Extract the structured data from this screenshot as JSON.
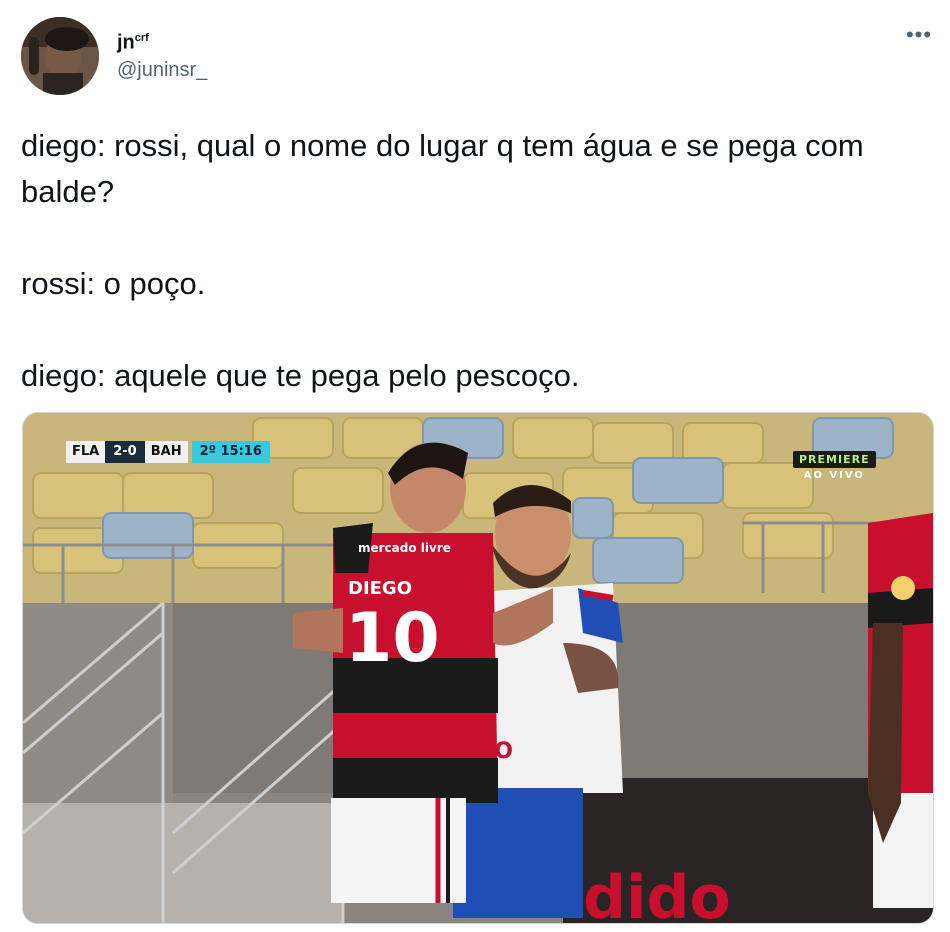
{
  "author": {
    "display_name": "jn",
    "display_name_sup": "crf",
    "handle": "@juninsr_",
    "avatar_icon": "avatar-photo"
  },
  "more_label": "•••",
  "tweet": {
    "lines": [
      "diego: rossi, qual o nome do lugar q tem água e se pega com balde?",
      "rossi: o poço.",
      "diego: aquele que te pega pelo pescoço."
    ]
  },
  "media": {
    "scorebug": {
      "home": "FLA",
      "score": "2-0",
      "away": "BAH",
      "period": "2º",
      "clock": "15:16"
    },
    "broadcast": {
      "brand": "PREMIERE",
      "live": "AO VIVO"
    },
    "jersey": {
      "name": "DIEGO",
      "number": "10",
      "sponsor": "mercado livre"
    },
    "colors": {
      "flamengo_red": "#c8102e",
      "flamengo_black": "#1a1a1a",
      "bahia_blue": "#1f4fb5",
      "seat_yellow": "#d8c27a",
      "seat_blue": "#9db3c8",
      "wall_gray": "#807a76"
    }
  }
}
